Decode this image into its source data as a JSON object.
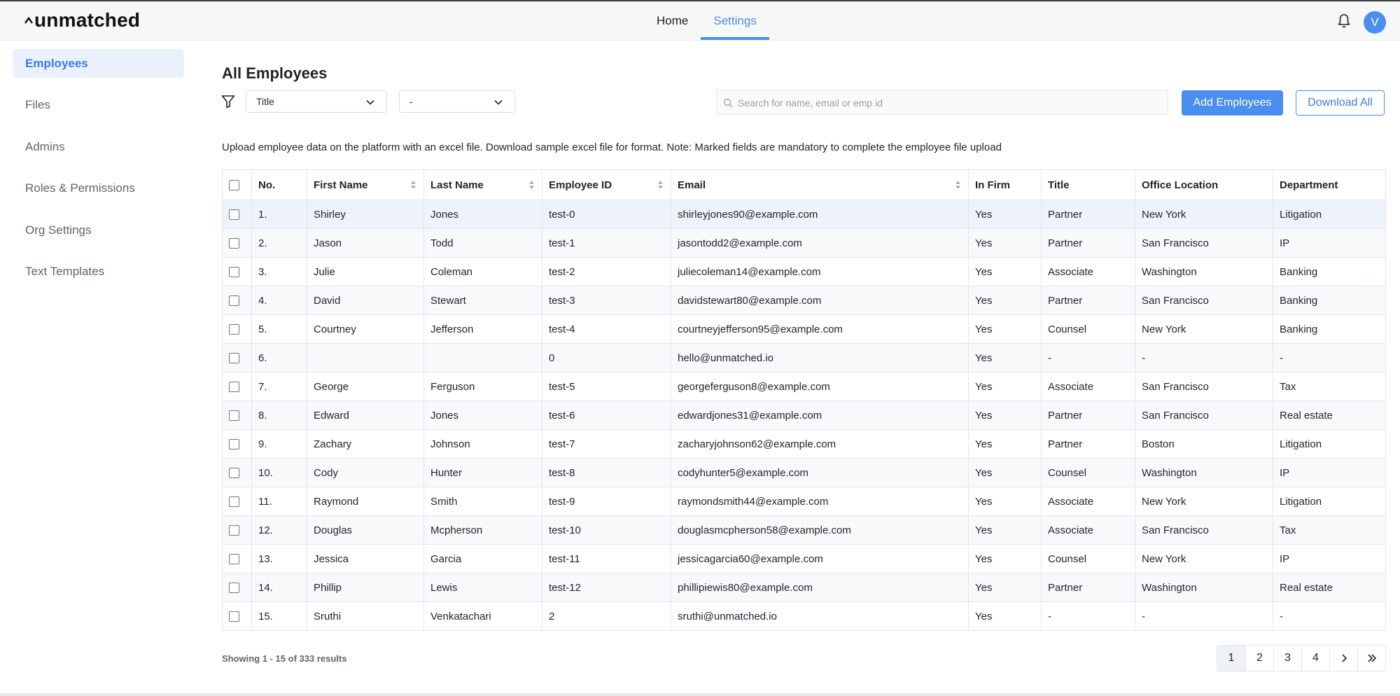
{
  "app": {
    "logo_text": "unmatched",
    "avatar_initial": "V"
  },
  "nav": {
    "tabs": [
      {
        "label": "Home"
      },
      {
        "label": "Settings"
      }
    ],
    "active": "Settings"
  },
  "sidebar": {
    "items": [
      {
        "label": "Employees",
        "active": true
      },
      {
        "label": "Files"
      },
      {
        "label": "Admins"
      },
      {
        "label": "Roles & Permissions"
      },
      {
        "label": "Org Settings"
      },
      {
        "label": "Text Templates"
      }
    ]
  },
  "main": {
    "title": "All Employees",
    "filter1_value": "Title",
    "filter2_value": "-",
    "search_placeholder": "Search for name, email or emp id",
    "add_button": "Add Employees",
    "download_button": "Download All",
    "description": "Upload employee data on the platform with an excel file. Download sample excel file for format. Note: Marked fields are mandatory to complete the employee file upload"
  },
  "table": {
    "columns": [
      "No.",
      "First Name",
      "Last Name",
      "Employee ID",
      "Email",
      "In Firm",
      "Title",
      "Office Location",
      "Department"
    ],
    "rows": [
      [
        "1.",
        "Shirley",
        "Jones",
        "test-0",
        "shirleyjones90@example.com",
        "Yes",
        "Partner",
        "New York",
        "Litigation"
      ],
      [
        "2.",
        "Jason",
        "Todd",
        "test-1",
        "jasontodd2@example.com",
        "Yes",
        "Partner",
        "San Francisco",
        "IP"
      ],
      [
        "3.",
        "Julie",
        "Coleman",
        "test-2",
        "juliecoleman14@example.com",
        "Yes",
        "Associate",
        "Washington",
        "Banking"
      ],
      [
        "4.",
        "David",
        "Stewart",
        "test-3",
        "davidstewart80@example.com",
        "Yes",
        "Partner",
        "San Francisco",
        "Banking"
      ],
      [
        "5.",
        "Courtney",
        "Jefferson",
        "test-4",
        "courtneyjefferson95@example.com",
        "Yes",
        "Counsel",
        "New York",
        "Banking"
      ],
      [
        "6.",
        "",
        "",
        "0",
        "hello@unmatched.io",
        "Yes",
        "-",
        "-",
        "-"
      ],
      [
        "7.",
        "George",
        "Ferguson",
        "test-5",
        "georgeferguson8@example.com",
        "Yes",
        "Associate",
        "San Francisco",
        "Tax"
      ],
      [
        "8.",
        "Edward",
        "Jones",
        "test-6",
        "edwardjones31@example.com",
        "Yes",
        "Partner",
        "San Francisco",
        "Real estate"
      ],
      [
        "9.",
        "Zachary",
        "Johnson",
        "test-7",
        "zacharyjohnson62@example.com",
        "Yes",
        "Partner",
        "Boston",
        "Litigation"
      ],
      [
        "10.",
        "Cody",
        "Hunter",
        "test-8",
        "codyhunter5@example.com",
        "Yes",
        "Counsel",
        "Washington",
        "IP"
      ],
      [
        "11.",
        "Raymond",
        "Smith",
        "test-9",
        "raymondsmith44@example.com",
        "Yes",
        "Associate",
        "New York",
        "Litigation"
      ],
      [
        "12.",
        "Douglas",
        "Mcpherson",
        "test-10",
        "douglasmcpherson58@example.com",
        "Yes",
        "Associate",
        "San Francisco",
        "Tax"
      ],
      [
        "13.",
        "Jessica",
        "Garcia",
        "test-11",
        "jessicagarcia60@example.com",
        "Yes",
        "Counsel",
        "New York",
        "IP"
      ],
      [
        "14.",
        "Phillip",
        "Lewis",
        "test-12",
        "phillipiewis80@example.com",
        "Yes",
        "Partner",
        "Washington",
        "Real estate"
      ],
      [
        "15.",
        "Sruthi",
        "Venkatachari",
        "2",
        "sruthi@unmatched.io",
        "Yes",
        "-",
        "-",
        "-"
      ]
    ]
  },
  "footer": {
    "showing": "Showing 1 - 15 of 333 results",
    "pages": [
      "1",
      "2",
      "3",
      "4"
    ],
    "current_page": "1"
  },
  "colors": {
    "accent": "#4a8ef0",
    "active_row": "#eef3fb",
    "sidebar_active_bg": "#eaf1fc"
  },
  "icons": [
    "bell-icon",
    "filter-icon",
    "chevron-down-icon",
    "search-icon",
    "sort-icon",
    "chevron-right-icon",
    "double-chevron-right-icon"
  ]
}
